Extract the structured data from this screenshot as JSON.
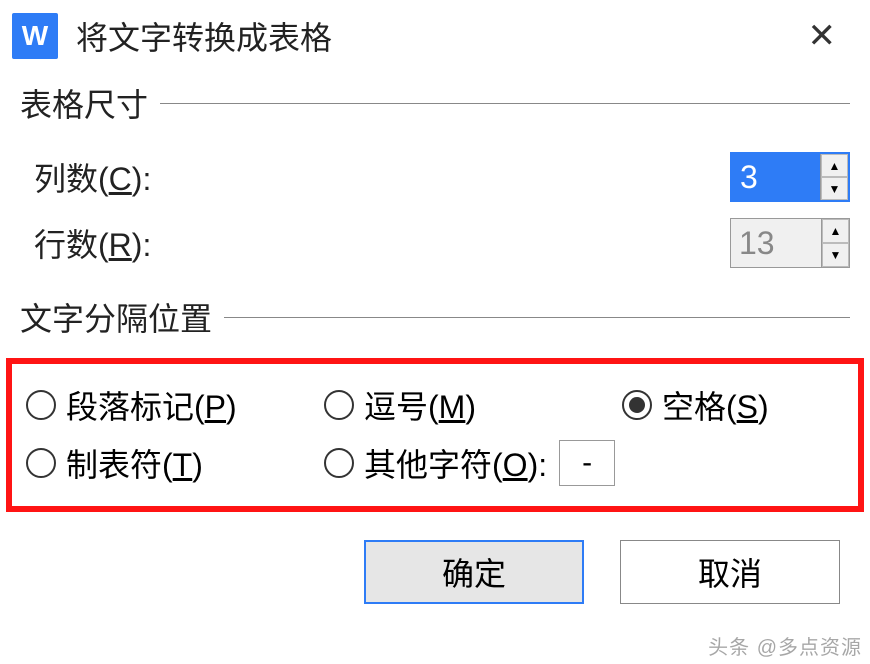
{
  "titlebar": {
    "app_icon_letter": "W",
    "title": "将文字转换成表格"
  },
  "table_size": {
    "legend": "表格尺寸",
    "columns_label_pre": "列数(",
    "columns_hotkey": "C",
    "columns_label_post": "):",
    "columns_value": "3",
    "rows_label_pre": "行数(",
    "rows_hotkey": "R",
    "rows_label_post": "):",
    "rows_value": "13"
  },
  "separator": {
    "legend": "文字分隔位置",
    "options": {
      "paragraph_pre": "段落标记(",
      "paragraph_hot": "P",
      "paragraph_post": ")",
      "comma_pre": "逗号(",
      "comma_hot": "M",
      "comma_post": ")",
      "space_pre": "空格(",
      "space_hot": "S",
      "space_post": ")",
      "tab_pre": "制表符(",
      "tab_hot": "T",
      "tab_post": ")",
      "other_pre": "其他字符(",
      "other_hot": "O",
      "other_post": "):",
      "other_value": "-"
    },
    "selected": "space"
  },
  "buttons": {
    "ok": "确定",
    "cancel": "取消"
  },
  "watermark": "头条 @多点资源"
}
